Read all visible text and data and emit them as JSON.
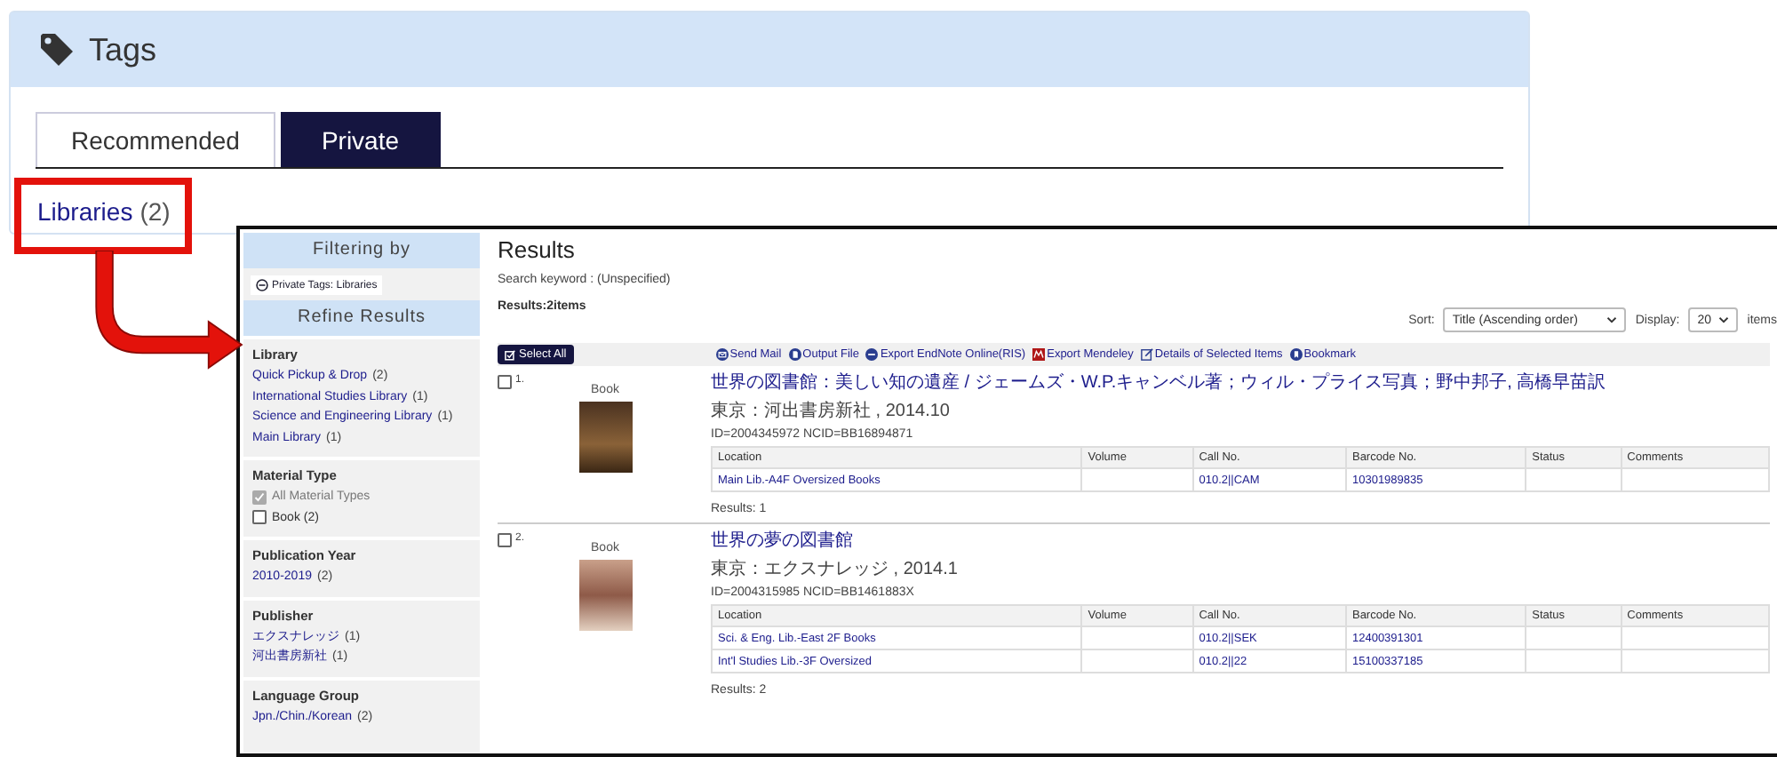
{
  "tags_panel": {
    "title": "Tags",
    "tabs": [
      {
        "label": "Recommended",
        "selected": false
      },
      {
        "label": "Private",
        "selected": true
      }
    ],
    "tag": {
      "name": "Libraries",
      "count": "(2)"
    }
  },
  "results_window": {
    "sidebar": {
      "filtering_header": "Filtering by",
      "active_filter": "Private Tags: Libraries",
      "refine_header": "Refine Results",
      "facets": [
        {
          "title": "Library",
          "items": [
            {
              "kind": "link",
              "label": "Quick Pickup & Drop",
              "count": "(2)"
            },
            {
              "kind": "link",
              "label": "International Studies Library",
              "count": "(1)"
            },
            {
              "kind": "link",
              "label": "Science and Engineering Library",
              "count": "(1)"
            },
            {
              "kind": "link",
              "label": "Main Library",
              "count": "(1)"
            }
          ]
        },
        {
          "title": "Material Type",
          "items": [
            {
              "kind": "checkbox",
              "label": "All Material Types",
              "checked": true,
              "disabled": true
            },
            {
              "kind": "checkbox",
              "label": "Book (2)",
              "checked": false,
              "disabled": false
            }
          ]
        },
        {
          "title": "Publication Year",
          "items": [
            {
              "kind": "link",
              "label": "2010-2019",
              "count": "(2)"
            }
          ]
        },
        {
          "title": "Publisher",
          "items": [
            {
              "kind": "link",
              "label": "エクスナレッジ",
              "count": "(1)"
            },
            {
              "kind": "link",
              "label": "河出書房新社",
              "count": "(1)"
            }
          ]
        },
        {
          "title": "Language Group",
          "items": [
            {
              "kind": "link",
              "label": "Jpn./Chin./Korean",
              "count": "(2)"
            }
          ]
        }
      ]
    },
    "main": {
      "title": "Results",
      "keyword": "Search keyword : (Unspecified)",
      "count": "Results:2items",
      "sort": {
        "label": "Sort:",
        "value": "Title (Ascending order)"
      },
      "display": {
        "label": "Display:",
        "value": "20",
        "unit": "items"
      },
      "select_all": "Select All",
      "actions": [
        {
          "kind": "mail",
          "label": "Send Mail"
        },
        {
          "kind": "file",
          "label": "Output File"
        },
        {
          "kind": "endnote",
          "label": "Export EndNote Online(RIS)"
        },
        {
          "kind": "mendeley",
          "label": "Export Mendeley"
        },
        {
          "kind": "details",
          "label": "Details of Selected Items"
        },
        {
          "kind": "bookmark",
          "label": "Bookmark"
        }
      ],
      "records": [
        {
          "number": "1.",
          "selected": false,
          "type": "Book",
          "title": "世界の図書館：美しい知の遺産 / ジェームズ・W.P.キャンベル著；ウィル・プライス写真；野中邦子, 高橋早苗訳",
          "publisher": "東京：河出書房新社 , 2014.10",
          "ids": "ID=2004345972 NCID=BB16894871",
          "columns": [
            "Location",
            "Volume",
            "Call No.",
            "Barcode No.",
            "Status",
            "Comments"
          ],
          "holdings": [
            {
              "location": "Main Lib.-A4F Oversized Books",
              "call_no": "010.2||CAM",
              "barcode": "10301989835"
            }
          ],
          "results": "Results: 1"
        },
        {
          "number": "2.",
          "selected": false,
          "type": "Book",
          "title": "世界の夢の図書館",
          "publisher": "東京：エクスナレッジ , 2014.1",
          "ids": "ID=2004315985 NCID=BB1461883X",
          "columns": [
            "Location",
            "Volume",
            "Call No.",
            "Barcode No.",
            "Status",
            "Comments"
          ],
          "holdings": [
            {
              "location": "Sci. & Eng. Lib.-East 2F Books",
              "call_no": "010.2||SEK",
              "barcode": "12400391301"
            },
            {
              "location": "Int'l Studies Lib.-3F Oversized",
              "call_no": "010.2||22",
              "barcode": "15100337185"
            }
          ],
          "results": "Results: 2"
        }
      ]
    }
  }
}
